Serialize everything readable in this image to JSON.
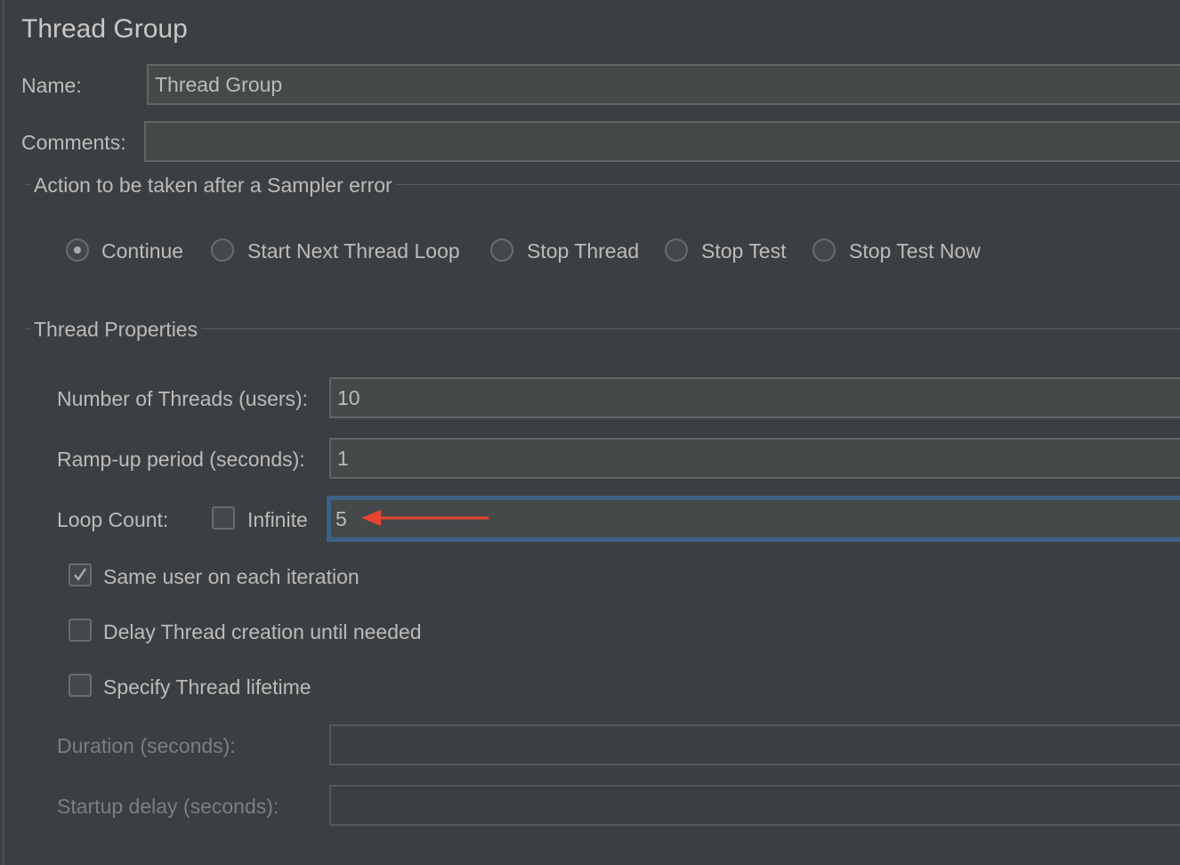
{
  "panel": {
    "title": "Thread Group",
    "name_label": "Name:",
    "name_value": "Thread Group",
    "comments_label": "Comments:",
    "comments_value": ""
  },
  "sampler_error": {
    "group_title": "Action to be taken after a Sampler error",
    "options": [
      {
        "label": "Continue",
        "selected": true
      },
      {
        "label": "Start Next Thread Loop",
        "selected": false
      },
      {
        "label": "Stop Thread",
        "selected": false
      },
      {
        "label": "Stop Test",
        "selected": false
      },
      {
        "label": "Stop Test Now",
        "selected": false
      }
    ]
  },
  "thread_properties": {
    "group_title": "Thread Properties",
    "num_threads_label": "Number of Threads (users):",
    "num_threads_value": "10",
    "ramp_up_label": "Ramp-up period (seconds):",
    "ramp_up_value": "1",
    "loop_count_label": "Loop Count:",
    "infinite_label": "Infinite",
    "infinite_checked": false,
    "loop_count_value": "5",
    "same_user_label": "Same user on each iteration",
    "same_user_checked": true,
    "delay_creation_label": "Delay Thread creation until needed",
    "delay_creation_checked": false,
    "specify_lifetime_label": "Specify Thread lifetime",
    "specify_lifetime_checked": false,
    "duration_label": "Duration (seconds):",
    "duration_value": "",
    "startup_delay_label": "Startup delay (seconds):",
    "startup_delay_value": ""
  },
  "annotation": {
    "arrow_color": "#e8432e",
    "focus_color": "#3d6185"
  }
}
